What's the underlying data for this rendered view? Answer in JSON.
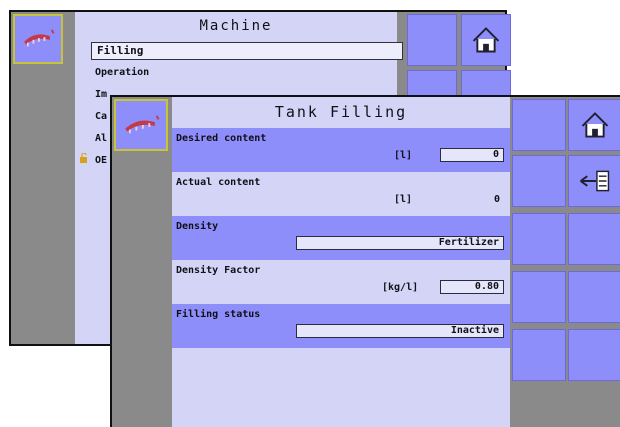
{
  "back_window": {
    "title": "Machine",
    "selected_field": "Filling",
    "menu_items": [
      "Operation",
      "Im",
      "Ca",
      "Al",
      "OE"
    ]
  },
  "front_window": {
    "title": "Tank Filling",
    "rows": [
      {
        "label": "Desired content",
        "unit": "[l]",
        "value": "0"
      },
      {
        "label": "Actual content",
        "unit": "[l]",
        "value": "0"
      },
      {
        "label": "Density",
        "value": "Fertilizer"
      },
      {
        "label": "Density Factor",
        "unit": "[kg/l]",
        "value": "0.80"
      },
      {
        "label": "Filling status",
        "value": "Inactive"
      }
    ]
  },
  "icons": {
    "home": "home-icon",
    "back": "back-arrow-icon",
    "logo": "sprayer-logo-icon",
    "lock": "unlock-icon"
  },
  "colors": {
    "panel": "#8e8efa",
    "content_bg": "#d4d4f6",
    "frame": "#8a8a8a",
    "logo_border": "#c8c43a"
  }
}
